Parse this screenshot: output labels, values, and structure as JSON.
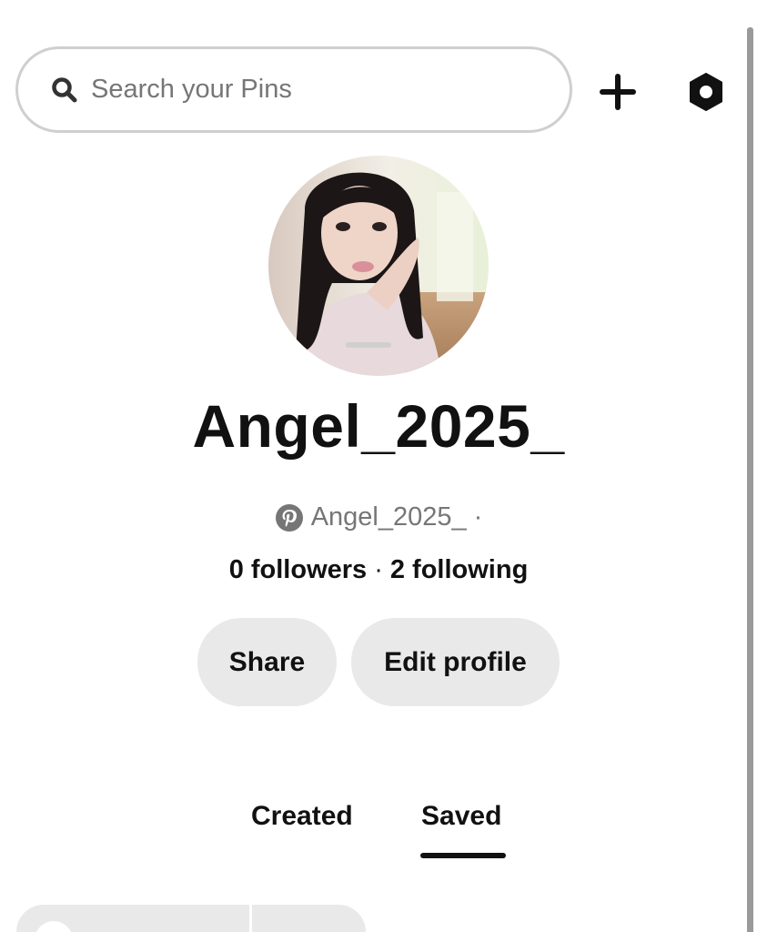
{
  "header": {
    "search": {
      "placeholder": "Search your Pins",
      "value": "",
      "icon": "search-icon"
    },
    "add_icon": "plus-icon",
    "settings_icon": "hexagon-gear-icon"
  },
  "profile": {
    "display_name": "Angel_2025_",
    "handle": "Angel_2025_",
    "handle_separator": "·",
    "followers": "0 followers",
    "stats_separator": "·",
    "following": "2 following",
    "share_label": "Share",
    "edit_label": "Edit profile"
  },
  "tabs": [
    {
      "label": "Created",
      "active": false
    },
    {
      "label": "Saved",
      "active": true
    }
  ],
  "colors": {
    "text": "#111111",
    "muted": "#767676",
    "button_bg": "#e9e9e9",
    "search_border": "#cfcfcf",
    "scrollbar": "#9a9a9a"
  }
}
